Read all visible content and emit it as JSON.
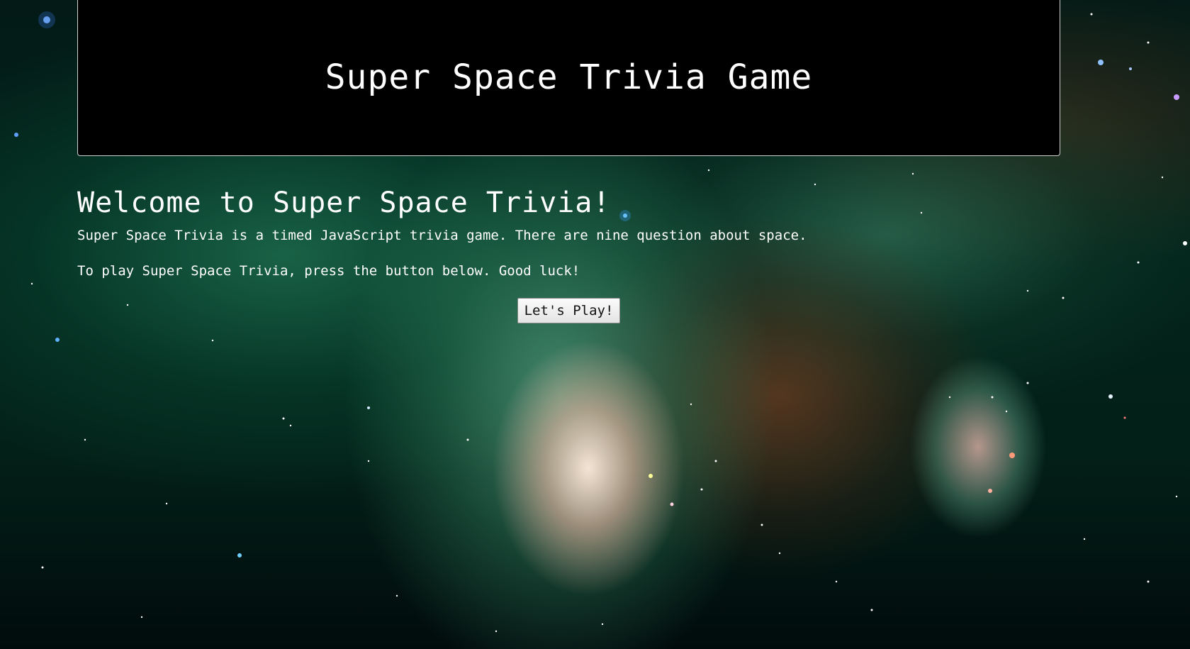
{
  "header": {
    "title": "Super Space Trivia Game"
  },
  "main": {
    "heading": "Welcome to Super Space Trivia!",
    "intro": "Super Space Trivia is a timed JavaScript trivia game. There are nine question about space.",
    "instructions": "To play Super Space Trivia, press the button below. Good luck!",
    "play_button_label": "Let's Play!"
  },
  "background": {
    "name": "nebula-background-image"
  },
  "colors": {
    "header_bg": "#000000",
    "header_border": "#cfcfcf",
    "text": "#ffffff",
    "button_bg": "#efefef",
    "button_text": "#111111"
  }
}
